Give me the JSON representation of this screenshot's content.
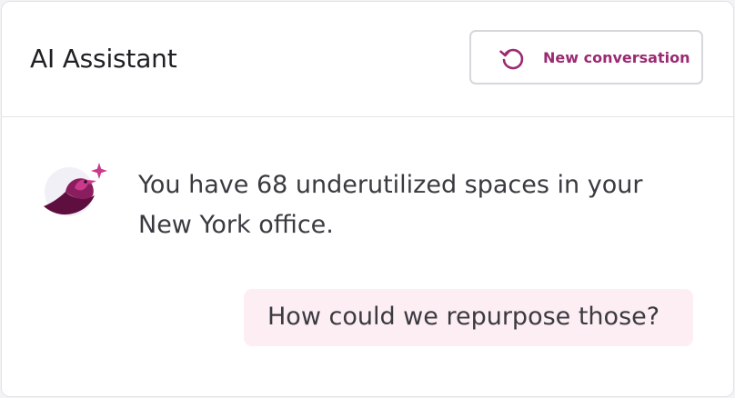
{
  "header": {
    "title": "AI Assistant",
    "new_conversation_label": "New conversation",
    "new_conversation_icon": "restart-icon"
  },
  "conversation": {
    "assistant_avatar_icon": "bird-sparkle-icon",
    "messages": [
      {
        "role": "assistant",
        "text": "You have 68 underutilized spaces in your New York office."
      },
      {
        "role": "user",
        "text": "How could we repurpose those?"
      }
    ]
  },
  "colors": {
    "accent": "#9b2a72",
    "user_bubble": "#fdeef3",
    "text": "#3a3a40"
  }
}
